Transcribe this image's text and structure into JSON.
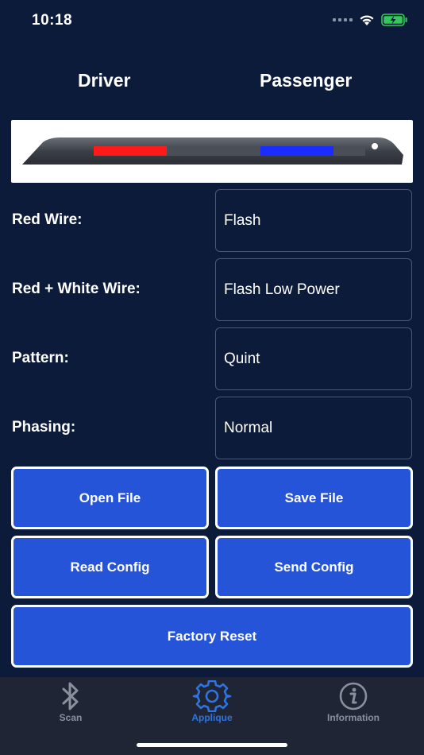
{
  "status": {
    "time": "10:18"
  },
  "sides": {
    "left": "Driver",
    "right": "Passenger"
  },
  "lightbar": {
    "left_color": "#ff1a1a",
    "right_color": "#1a2cff"
  },
  "fields": [
    {
      "label": "Red Wire:",
      "value": "Flash"
    },
    {
      "label": "Red + White Wire:",
      "value": "Flash Low Power"
    },
    {
      "label": "Pattern:",
      "value": "Quint"
    },
    {
      "label": "Phasing:",
      "value": "Normal"
    }
  ],
  "buttons": {
    "open_file": "Open File",
    "save_file": "Save File",
    "read_config": "Read Config",
    "send_config": "Send Config",
    "factory_reset": "Factory Reset"
  },
  "tabs": [
    {
      "label": "Scan",
      "icon": "bluetooth-icon",
      "active": false
    },
    {
      "label": "Applique",
      "icon": "gear-icon",
      "active": true
    },
    {
      "label": "Information",
      "icon": "info-icon",
      "active": false
    }
  ],
  "colors": {
    "background": "#0d1b3a",
    "button": "#2554d8",
    "tab_active": "#2f74e0",
    "tab_inactive": "#8a8f9c"
  }
}
